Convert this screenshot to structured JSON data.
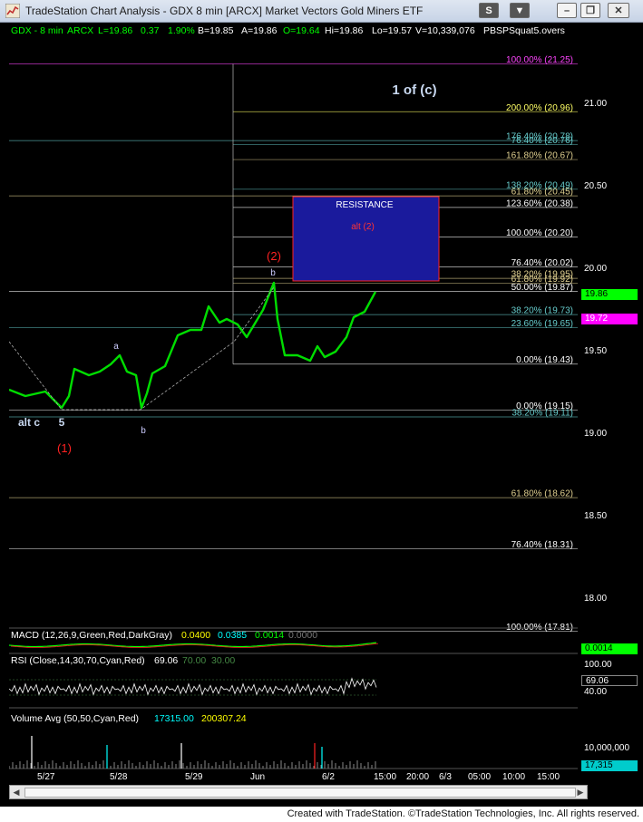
{
  "window": {
    "title": "TradeStation Chart Analysis - GDX 8 min [ARCX] Market Vectors Gold Miners ETF",
    "buttons": {
      "s": "S",
      "menu": "▼",
      "minimize": "–",
      "restore": "❐",
      "close": "✕"
    }
  },
  "info_bar": {
    "symbol": "GDX - 8 min",
    "exchange": "ARCX",
    "last": "L=19.86",
    "change": "0.37",
    "pct": "1.90%",
    "bid": "B=19.85",
    "ask": "A=19.86",
    "open": "O=19.64",
    "high": "Hi=19.86",
    "low": "Lo=19.57",
    "volume": "V=10,339,076",
    "study": "PBSPSquat5.overs"
  },
  "price_axis": {
    "ticks": [
      "21.00",
      "20.50",
      "20.00",
      "19.50",
      "19.00",
      "18.50",
      "18.00"
    ],
    "last_badge": "19.86",
    "second_badge": "19.72",
    "macd_badge": "0.0014",
    "rsi_ticks": [
      "100.00",
      "40.00"
    ],
    "rsi_badge": "69.06",
    "vol_tick": "10,000,000",
    "vol_badge": "17,315"
  },
  "fib_labels": [
    {
      "text": "100.00% (21.25)",
      "price": 21.25,
      "color": "#ff44ff"
    },
    {
      "text": "200.00% (20.96)",
      "price": 20.96,
      "color": "#ffff66"
    },
    {
      "text": "176.40% (20.78)",
      "price": 20.785,
      "color": "#66cccc"
    },
    {
      "text": "76.40% (20.76)",
      "price": 20.76,
      "color": "#66cccc"
    },
    {
      "text": "161.80% (20.67)",
      "price": 20.67,
      "color": "#e0d090"
    },
    {
      "text": "138.20% (20.49)",
      "price": 20.49,
      "color": "#66cccc"
    },
    {
      "text": "61.80% (20.45)",
      "price": 20.45,
      "color": "#e0d090"
    },
    {
      "text": "123.60% (20.38)",
      "price": 20.38,
      "color": "#ffffff"
    },
    {
      "text": "100.00% (20.20)",
      "price": 20.2,
      "color": "#ffffff"
    },
    {
      "text": "76.40% (20.02)",
      "price": 20.02,
      "color": "#ffffff"
    },
    {
      "text": "38.20% (19.95)",
      "price": 19.95,
      "color": "#e0d090"
    },
    {
      "text": "61.80% (19.92)",
      "price": 19.92,
      "color": "#e0d090"
    },
    {
      "text": "50.00% (19.87)",
      "price": 19.87,
      "color": "#ffffff"
    },
    {
      "text": "38.20% (19.73)",
      "price": 19.73,
      "color": "#66cccc"
    },
    {
      "text": "23.60% (19.65)",
      "price": 19.65,
      "color": "#66cccc"
    },
    {
      "text": "0.00% (19.43)",
      "price": 19.43,
      "color": "#ffffff"
    },
    {
      "text": "0.00% (19.15)",
      "price": 19.15,
      "color": "#ffffff"
    },
    {
      "text": "38.20% (19.11)",
      "price": 19.11,
      "color": "#66cccc"
    },
    {
      "text": "61.80% (18.62)",
      "price": 18.62,
      "color": "#e0d090"
    },
    {
      "text": "76.40% (18.31)",
      "price": 18.31,
      "color": "#ffffff"
    },
    {
      "text": "100.00% (17.81)",
      "price": 17.81,
      "color": "#ffffff"
    }
  ],
  "annotations": {
    "wave_main": "1 of (c)",
    "resistance": "RESISTANCE",
    "alt2": "alt (2)",
    "wave2": "(2)",
    "b_top": "b",
    "a_label": "a",
    "b_low": "b",
    "alt_c": "alt c",
    "five": "5",
    "wave1": "(1)"
  },
  "macd": {
    "label": "MACD (12,26,9,Green,Red,DarkGray)",
    "v1": "0.0400",
    "v2": "0.0385",
    "v3": "0.0014",
    "v4": "0.0000"
  },
  "rsi": {
    "label": "RSI (Close,14,30,70,Cyan,Red)",
    "v1": "69.06",
    "v2": "70.00",
    "v3": "30.00"
  },
  "volume": {
    "label": "Volume Avg (50,50,Cyan,Red)",
    "v1": "17315.00",
    "v2": "200307.24"
  },
  "time_axis": [
    "5/27",
    "5/28",
    "5/29",
    "Jun",
    "6/2",
    "15:00",
    "20:00",
    "6/3",
    "05:00",
    "10:00",
    "15:00"
  ],
  "footer": "Created with TradeStation. ©TradeStation Technologies, Inc. All rights reserved.",
  "colors": {
    "price": "#00dd00",
    "resistance_fill": "#1a1a9c",
    "badge_green": "#00ff00",
    "badge_magenta": "#ff00ff"
  }
}
